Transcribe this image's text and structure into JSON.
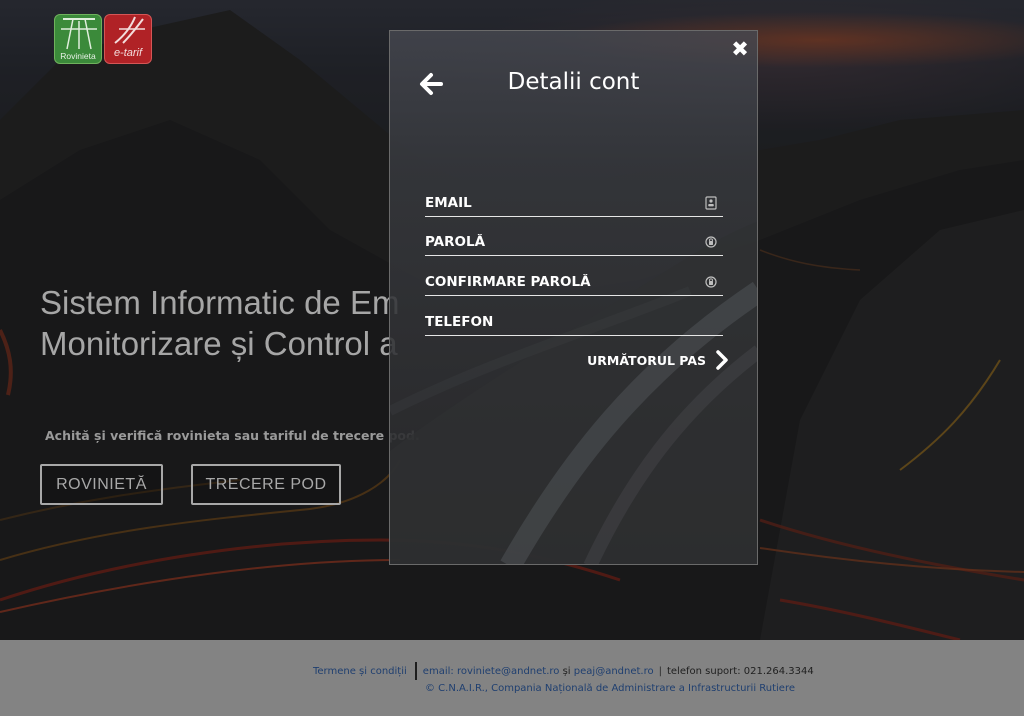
{
  "logos": {
    "rovinieta": "Rovinieta",
    "etarif": "e-tarif"
  },
  "hero": {
    "title_line1": "Sistem Informatic de Emitere,",
    "title_line2": "Monitorizare și Control a",
    "tagline": "Achită și verifică rovinieta sau tariful de trecere pod.",
    "button_rovinieta": "ROVINIETĂ",
    "button_pod": "TRECERE POD"
  },
  "modal": {
    "title": "Detalii cont",
    "close_glyph": "✖",
    "fields": {
      "email_placeholder": "EMAIL",
      "password_placeholder": "PAROLĂ",
      "confirm_placeholder": "CONFIRMARE PAROLĂ",
      "phone_placeholder": "TELEFON"
    },
    "next_label": "URMĂTORUL PAS"
  },
  "footer": {
    "terms": "Termene și condiții",
    "email_prefix": "email:",
    "email1": "roviniete@andnet.ro",
    "and": "și",
    "email2": "peaj@andnet.ro",
    "separator": "|",
    "phone": "telefon suport: 021.264.3344",
    "copyright": "© C.N.A.I.R., Compania Națională de Administrare a Infrastructurii Rutiere"
  },
  "colors": {
    "footer_bg": "#838383",
    "footer_link": "#1f3f70",
    "logo_green": "#3b8a3a",
    "logo_red": "#b02226"
  }
}
